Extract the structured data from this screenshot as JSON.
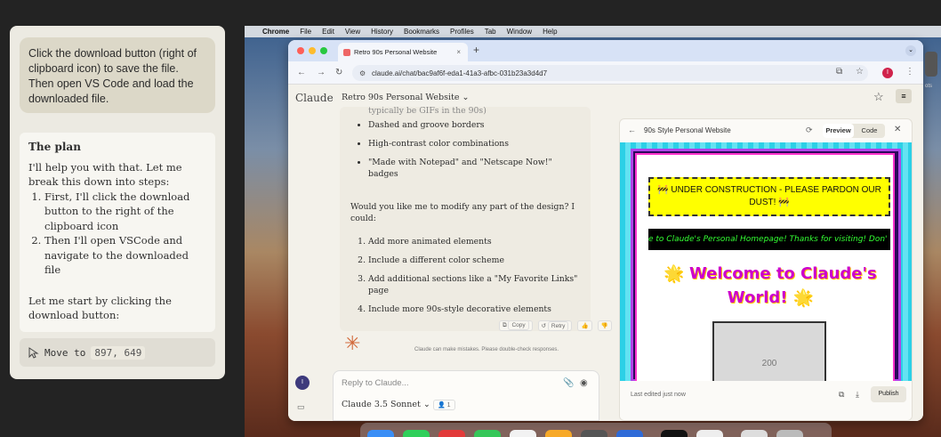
{
  "agent": {
    "user_message": "Click the download button (right of clipboard icon) to save the file. Then open VS Code and load the downloaded file.",
    "plan_title": "The plan",
    "plan_intro": "I'll help you with that. Let me break this down into steps:",
    "steps": [
      "First, I'll click the download button to the right of the clipboard icon",
      "Then I'll open VSCode and navigate to the downloaded file"
    ],
    "plan_end": "Let me start by clicking the download button:",
    "action_label": "Move to",
    "action_coords": "897, 649"
  },
  "menubar": {
    "app": "Chrome",
    "items": [
      "File",
      "Edit",
      "View",
      "History",
      "Bookmarks",
      "Profiles",
      "Tab",
      "Window",
      "Help"
    ]
  },
  "browser": {
    "tab_title": "Retro 90s Personal Website",
    "tab_close": "×",
    "new_tab": "+",
    "url": "claude.ai/chat/bac9af6f-eda1-41a3-afbc-031b23a3d4d7",
    "avatar_letter": "I"
  },
  "claude": {
    "logo": "Claude",
    "chat_title": "Retro 90s Personal Website ⌄",
    "faded_line": "typically be GIFs in the 90s)",
    "bullets": [
      "Dashed and groove borders",
      "High-contrast color combinations",
      "\"Made with Notepad\" and \"Netscape Now!\" badges"
    ],
    "question": "Would you like me to modify any part of the design? I could:",
    "options": [
      "Add more animated elements",
      "Include a different color scheme",
      "Add additional sections like a \"My Favorite Links\" page",
      "Include more 90s-style decorative elements"
    ],
    "copy_label": "Copy",
    "retry_label": "Retry",
    "disclaimer": "Claude can make mistakes. Please double-check responses.",
    "user_initial": "I",
    "reply_placeholder": "Reply to Claude...",
    "model": "Claude 3.5 Sonnet ⌄",
    "badge": "1"
  },
  "artifact": {
    "title": "90s Style Personal Website",
    "preview_tab": "Preview",
    "code_tab": "Code",
    "construction_text": "🚧 UNDER CONSTRUCTION - PLEASE PARDON OUR DUST! 🚧",
    "marquee_text": "e to Claude's Personal Homepage! Thanks for visiting! Don'",
    "welcome_text": "🌟 Welcome to Claude's World! 🌟",
    "image_placeholder": "200",
    "last_edited": "Last edited just now",
    "publish_label": "Publish"
  },
  "right_edge_text": "ots"
}
